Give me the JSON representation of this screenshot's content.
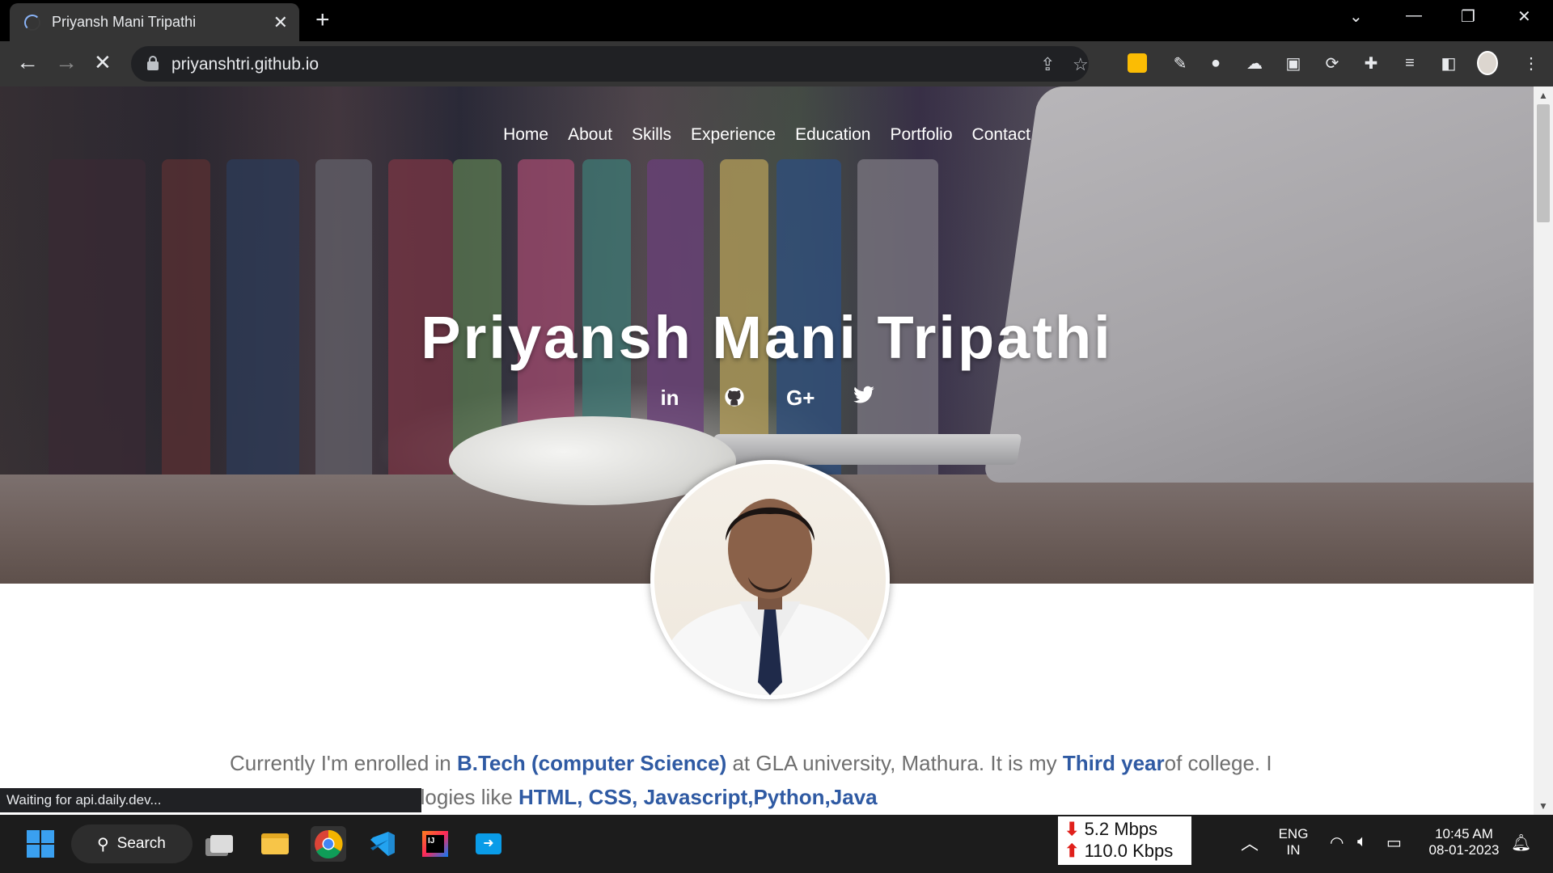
{
  "browser": {
    "tab_title": "Priyansh Mani Tripathi",
    "url": "priyanshtri.github.io",
    "status_text": "Waiting for api.daily.dev..."
  },
  "site": {
    "nav": [
      "Home",
      "About",
      "Skills",
      "Experience",
      "Education",
      "Portfolio",
      "Contact"
    ],
    "name": "Priyansh Mani Tripathi",
    "social": [
      "in",
      "G+"
    ],
    "about": {
      "t1": "Currently I'm enrolled in ",
      "b1": "B.Tech (computer Science)",
      "t2": " at GLA university, Mathura. It is my ",
      "b2": "Third year",
      "t3": "of college. I have learned technologies like ",
      "b3": "HTML, CSS, Javascript,Python,Java"
    }
  },
  "taskbar": {
    "search_label": "Search",
    "net_down": "5.2 Mbps",
    "net_up": "110.0 Kbps",
    "lang_1": "ENG",
    "lang_2": "IN",
    "time": "10:45 AM",
    "date": "08-01-2023"
  },
  "colors": {
    "accent_link": "#2f5aa3",
    "browser_dark": "#353535"
  }
}
